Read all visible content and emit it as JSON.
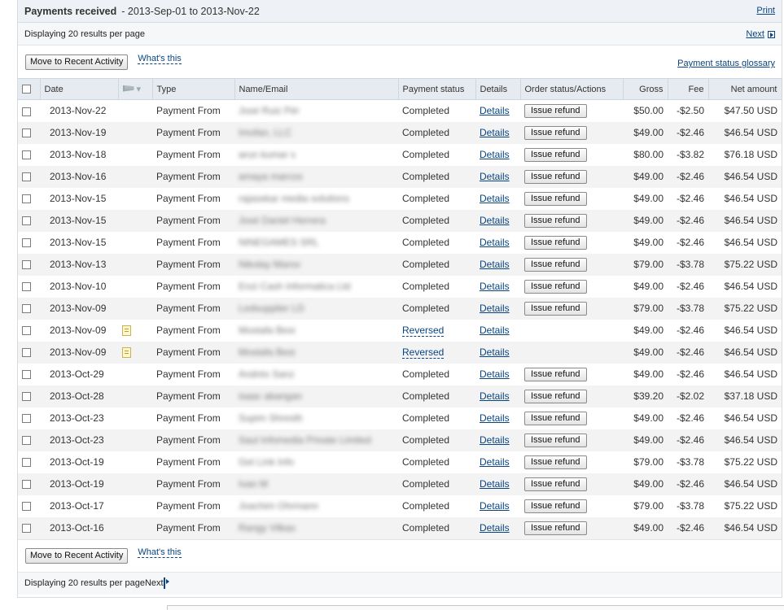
{
  "header": {
    "title": "Payments received",
    "range": "- 2013-Sep-01 to 2013-Nov-22",
    "print_label": "Print"
  },
  "pager": {
    "display_text": "Displaying 20 results per page",
    "next_label": "Next"
  },
  "actions": {
    "move_label": "Move to Recent Activity",
    "whats_this": "What's this",
    "glossary": "Payment status glossary"
  },
  "columns": {
    "date": "Date",
    "type": "Type",
    "name": "Name/Email",
    "status": "Payment status",
    "details": "Details",
    "order": "Order status/Actions",
    "gross": "Gross",
    "fee": "Fee",
    "net": "Net amount"
  },
  "rows": [
    {
      "date": "2013-Nov-22",
      "note": false,
      "type": "Payment From",
      "name": "José Ruiz Pér",
      "status": "Completed",
      "reversed": false,
      "details": "Details",
      "refund": "Issue refund",
      "gross": "$50.00",
      "fee": "-$2.50",
      "net": "$47.50 USD"
    },
    {
      "date": "2013-Nov-19",
      "note": false,
      "type": "Payment From",
      "name": "Imofan, LLC",
      "status": "Completed",
      "reversed": false,
      "details": "Details",
      "refund": "Issue refund",
      "gross": "$49.00",
      "fee": "-$2.46",
      "net": "$46.54 USD"
    },
    {
      "date": "2013-Nov-18",
      "note": false,
      "type": "Payment From",
      "name": "arun kumar s",
      "status": "Completed",
      "reversed": false,
      "details": "Details",
      "refund": "Issue refund",
      "gross": "$80.00",
      "fee": "-$3.82",
      "net": "$76.18 USD"
    },
    {
      "date": "2013-Nov-16",
      "note": false,
      "type": "Payment From",
      "name": "amaya marcos",
      "status": "Completed",
      "reversed": false,
      "details": "Details",
      "refund": "Issue refund",
      "gross": "$49.00",
      "fee": "-$2.46",
      "net": "$46.54 USD"
    },
    {
      "date": "2013-Nov-15",
      "note": false,
      "type": "Payment From",
      "name": "rajasekar media solutions",
      "status": "Completed",
      "reversed": false,
      "details": "Details",
      "refund": "Issue refund",
      "gross": "$49.00",
      "fee": "-$2.46",
      "net": "$46.54 USD"
    },
    {
      "date": "2013-Nov-15",
      "note": false,
      "type": "Payment From",
      "name": "José Daniel Herrera",
      "status": "Completed",
      "reversed": false,
      "details": "Details",
      "refund": "Issue refund",
      "gross": "$49.00",
      "fee": "-$2.46",
      "net": "$46.54 USD"
    },
    {
      "date": "2013-Nov-15",
      "note": false,
      "type": "Payment From",
      "name": "NINEGAMES SRL",
      "status": "Completed",
      "reversed": false,
      "details": "Details",
      "refund": "Issue refund",
      "gross": "$49.00",
      "fee": "-$2.46",
      "net": "$46.54 USD"
    },
    {
      "date": "2013-Nov-13",
      "note": false,
      "type": "Payment From",
      "name": "Nikolay Marov",
      "status": "Completed",
      "reversed": false,
      "details": "Details",
      "refund": "Issue refund",
      "gross": "$79.00",
      "fee": "-$3.78",
      "net": "$75.22 USD"
    },
    {
      "date": "2013-Nov-10",
      "note": false,
      "type": "Payment From",
      "name": "Enzi Cash Informatica Ltd",
      "status": "Completed",
      "reversed": false,
      "details": "Details",
      "refund": "Issue refund",
      "gross": "$49.00",
      "fee": "-$2.46",
      "net": "$46.54 USD"
    },
    {
      "date": "2013-Nov-09",
      "note": false,
      "type": "Payment From",
      "name": "Ledsupplier LD",
      "status": "Completed",
      "reversed": false,
      "details": "Details",
      "refund": "Issue refund",
      "gross": "$79.00",
      "fee": "-$3.78",
      "net": "$75.22 USD"
    },
    {
      "date": "2013-Nov-09",
      "note": true,
      "type": "Payment From",
      "name": "Mostafa Besi",
      "status": "Reversed",
      "reversed": true,
      "details": "Details",
      "refund": "",
      "gross": "$49.00",
      "fee": "-$2.46",
      "net": "$46.54 USD"
    },
    {
      "date": "2013-Nov-09",
      "note": true,
      "type": "Payment From",
      "name": "Mostafa Besi",
      "status": "Reversed",
      "reversed": true,
      "details": "Details",
      "refund": "",
      "gross": "$49.00",
      "fee": "-$2.46",
      "net": "$46.54 USD"
    },
    {
      "date": "2013-Oct-29",
      "note": false,
      "type": "Payment From",
      "name": "Andrés Sanz",
      "status": "Completed",
      "reversed": false,
      "details": "Details",
      "refund": "Issue refund",
      "gross": "$49.00",
      "fee": "-$2.46",
      "net": "$46.54 USD"
    },
    {
      "date": "2013-Oct-28",
      "note": false,
      "type": "Payment From",
      "name": "isaac abangan",
      "status": "Completed",
      "reversed": false,
      "details": "Details",
      "refund": "Issue refund",
      "gross": "$39.20",
      "fee": "-$2.02",
      "net": "$37.18 USD"
    },
    {
      "date": "2013-Oct-23",
      "note": false,
      "type": "Payment From",
      "name": "Supim Shresth",
      "status": "Completed",
      "reversed": false,
      "details": "Details",
      "refund": "Issue refund",
      "gross": "$49.00",
      "fee": "-$2.46",
      "net": "$46.54 USD"
    },
    {
      "date": "2013-Oct-23",
      "note": false,
      "type": "Payment From",
      "name": "Saul Infomedia Private Limited",
      "status": "Completed",
      "reversed": false,
      "details": "Details",
      "refund": "Issue refund",
      "gross": "$49.00",
      "fee": "-$2.46",
      "net": "$46.54 USD"
    },
    {
      "date": "2013-Oct-19",
      "note": false,
      "type": "Payment From",
      "name": "Get Link Info",
      "status": "Completed",
      "reversed": false,
      "details": "Details",
      "refund": "Issue refund",
      "gross": "$79.00",
      "fee": "-$3.78",
      "net": "$75.22 USD"
    },
    {
      "date": "2013-Oct-19",
      "note": false,
      "type": "Payment From",
      "name": "Ivan M",
      "status": "Completed",
      "reversed": false,
      "details": "Details",
      "refund": "Issue refund",
      "gross": "$49.00",
      "fee": "-$2.46",
      "net": "$46.54 USD"
    },
    {
      "date": "2013-Oct-17",
      "note": false,
      "type": "Payment From",
      "name": "Joachim Ohrmann",
      "status": "Completed",
      "reversed": false,
      "details": "Details",
      "refund": "Issue refund",
      "gross": "$79.00",
      "fee": "-$3.78",
      "net": "$75.22 USD"
    },
    {
      "date": "2013-Oct-16",
      "note": false,
      "type": "Payment From",
      "name": "Rangy Vilkas",
      "status": "Completed",
      "reversed": false,
      "details": "Details",
      "refund": "Issue refund",
      "gross": "$49.00",
      "fee": "-$2.46",
      "net": "$46.54 USD"
    }
  ]
}
